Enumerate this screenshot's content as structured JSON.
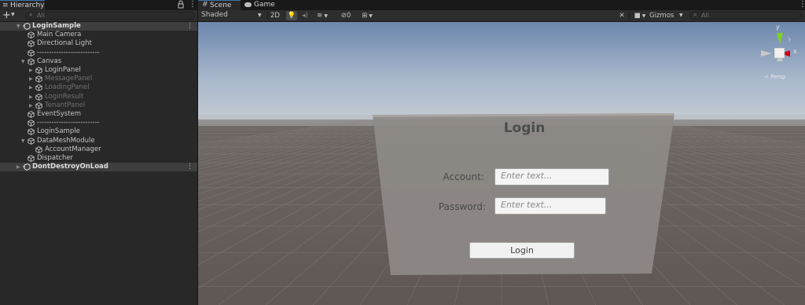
{
  "hierarchy": {
    "tab_label": "Hierarchy",
    "add_label": "+",
    "search_placeholder": "All",
    "items": [
      {
        "label": "LoginSample",
        "depth": 0,
        "expanded": true,
        "selected": true,
        "dimmed": false,
        "scene": true
      },
      {
        "label": "Main Camera",
        "depth": 1
      },
      {
        "label": "Directional Light",
        "depth": 1
      },
      {
        "label": "--------------------------",
        "depth": 1
      },
      {
        "label": "Canvas",
        "depth": 1,
        "expanded": true
      },
      {
        "label": "LoginPanel",
        "depth": 2,
        "collapsed": true
      },
      {
        "label": "MessagePanel",
        "depth": 2,
        "collapsed": true,
        "dimmed": true
      },
      {
        "label": "LoadingPanel",
        "depth": 2,
        "collapsed": true,
        "dimmed": true
      },
      {
        "label": "LoginResult",
        "depth": 2,
        "collapsed": true,
        "dimmed": true
      },
      {
        "label": "TenantPanel",
        "depth": 2,
        "collapsed": true,
        "dimmed": true
      },
      {
        "label": "EventSystem",
        "depth": 1
      },
      {
        "label": "--------------------------",
        "depth": 1
      },
      {
        "label": "LoginSample",
        "depth": 1
      },
      {
        "label": "DataMeshModule",
        "depth": 1,
        "expanded": true
      },
      {
        "label": "AccountManager",
        "depth": 2
      },
      {
        "label": "Dispatcher",
        "depth": 1
      },
      {
        "label": "DontDestroyOnLoad",
        "depth": 0,
        "collapsed": true,
        "selected": true,
        "scene": true
      }
    ]
  },
  "scene_tabs": {
    "scene_label": "Scene",
    "game_label": "Game"
  },
  "scene_toolbar": {
    "shading_mode": "Shaded",
    "mode_2d": "2D",
    "hidden_count": "0",
    "gizmos_label": "Gizmos",
    "search_placeholder": "All"
  },
  "gizmo": {
    "y_label": "y",
    "x_label": "x",
    "persp_label": "< Persp"
  },
  "login_ui": {
    "title": "Login",
    "account_label": "Account:",
    "password_label": "Password:",
    "account_placeholder": "Enter text...",
    "password_placeholder": "Enter text...",
    "login_button": "Login"
  },
  "colors": {
    "accent": "#3a72b0",
    "gizmo_y": "#7ed321",
    "gizmo_x": "#d0021b"
  }
}
